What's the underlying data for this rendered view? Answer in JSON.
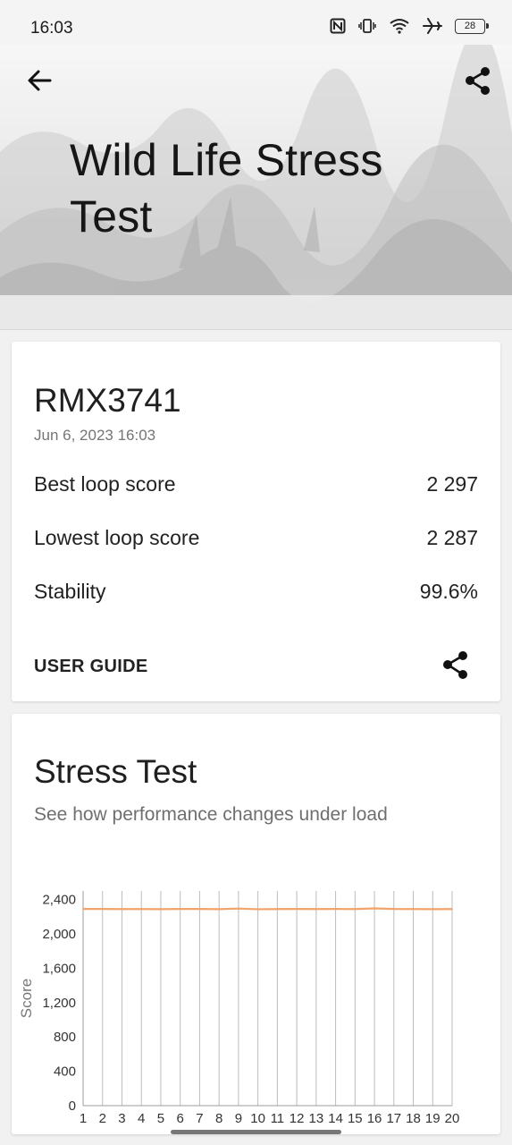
{
  "status_bar": {
    "time": "16:03",
    "battery": "28"
  },
  "hero": {
    "title": "Wild Life Stress Test"
  },
  "result": {
    "device": "RMX3741",
    "date": "Jun 6, 2023 16:03",
    "rows": [
      {
        "label": "Best loop score",
        "value": "2 297"
      },
      {
        "label": "Lowest loop score",
        "value": "2 287"
      },
      {
        "label": "Stability",
        "value": "99.6%"
      }
    ],
    "user_guide": "USER GUIDE"
  },
  "stress": {
    "title": "Stress Test",
    "subtitle": "See how performance changes under load"
  },
  "chart_data": {
    "type": "line",
    "x": [
      1,
      2,
      3,
      4,
      5,
      6,
      7,
      8,
      9,
      10,
      11,
      12,
      13,
      14,
      15,
      16,
      17,
      18,
      19,
      20
    ],
    "series": [
      {
        "values": [
          2290,
          2290,
          2289,
          2289,
          2288,
          2290,
          2290,
          2288,
          2295,
          2287,
          2289,
          2290,
          2289,
          2290,
          2289,
          2297,
          2290,
          2289,
          2288,
          2289
        ]
      }
    ],
    "ylabel": "Score",
    "xlabel": "",
    "ylim": [
      0,
      2500
    ],
    "yticks": [
      0,
      400,
      800,
      1200,
      1600,
      2000,
      2400
    ],
    "ytick_labels": [
      "0",
      "400",
      "800",
      "1,200",
      "1,600",
      "2,000",
      "2,400"
    ],
    "grid": "vertical",
    "line_color": "#f0a36b"
  }
}
